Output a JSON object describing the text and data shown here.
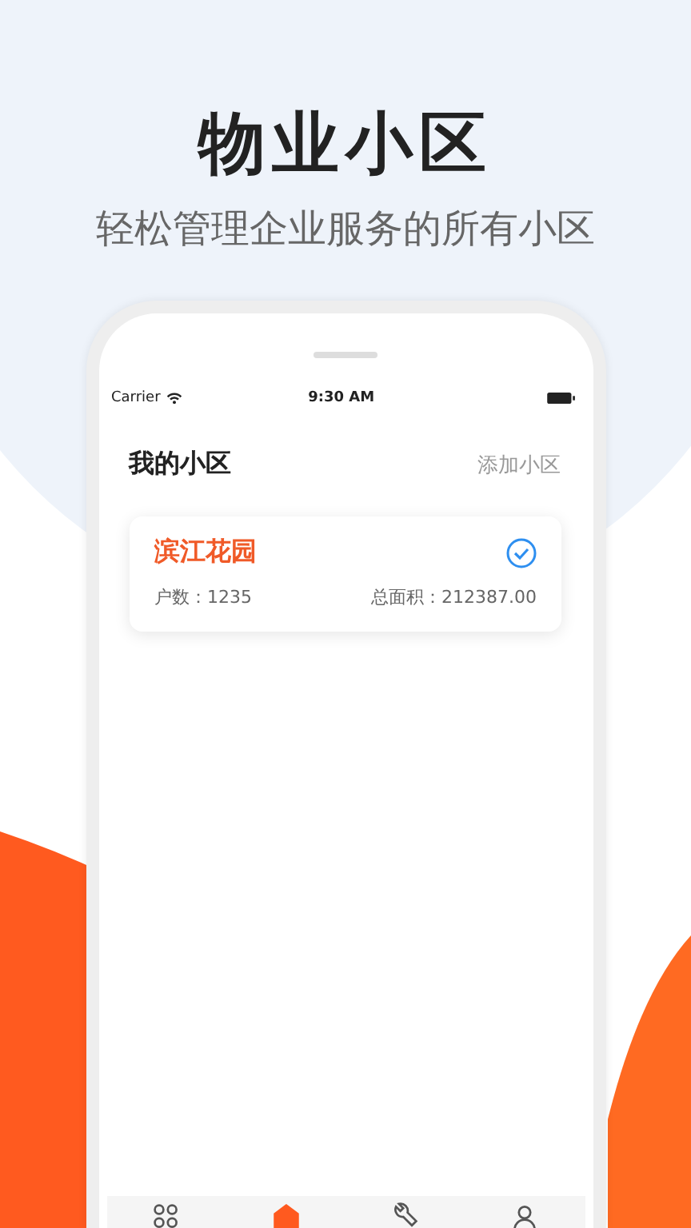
{
  "header": {
    "title": "物业小区",
    "subtitle": "轻松管理企业服务的所有小区"
  },
  "status_bar": {
    "carrier": "Carrier",
    "time": "9:30 AM"
  },
  "page": {
    "title": "我的小区",
    "action": "添加小区"
  },
  "communities": [
    {
      "name": "滨江花园",
      "households": "户数：1235",
      "area": "总面积：212387.00",
      "selected": true
    }
  ],
  "tab_bar": [
    {
      "kind": "grid",
      "selected": false
    },
    {
      "kind": "home",
      "selected": true
    },
    {
      "kind": "wrench",
      "selected": false
    },
    {
      "kind": "person",
      "selected": false
    }
  ]
}
